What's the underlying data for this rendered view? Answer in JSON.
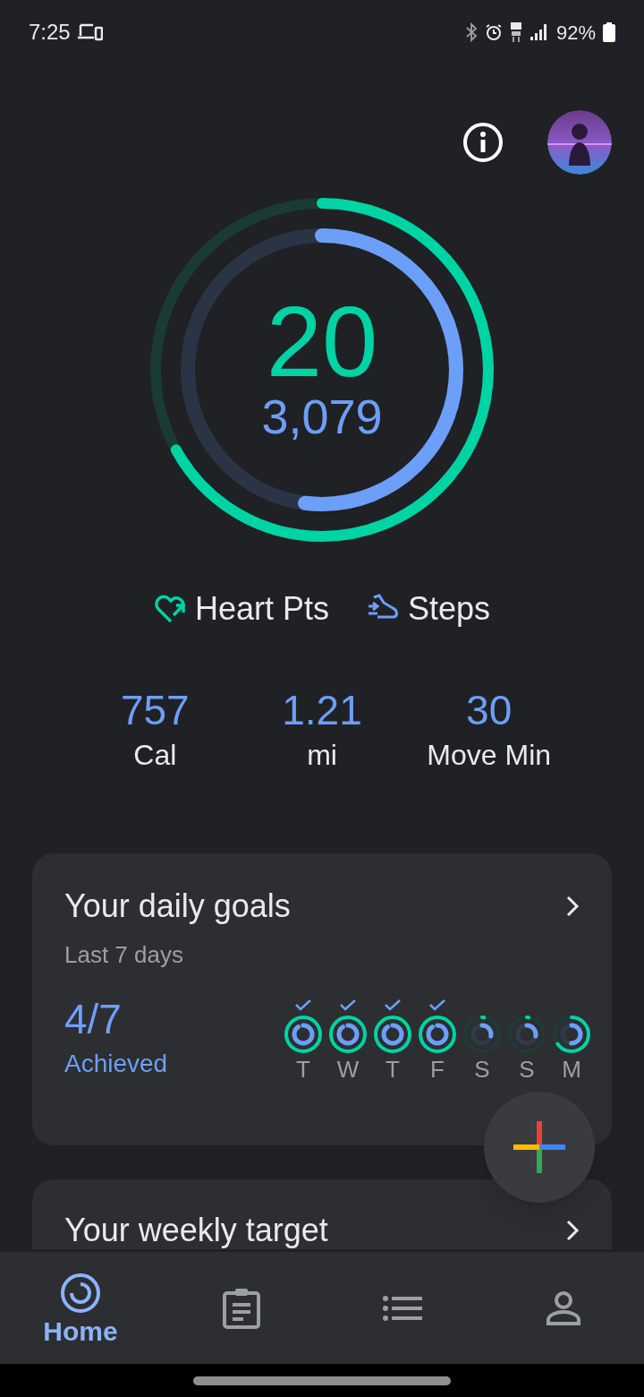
{
  "status_bar": {
    "time": "7:25",
    "battery": "92%"
  },
  "rings": {
    "heart_points": {
      "value": "20",
      "level": 0.67
    },
    "steps": {
      "value": "3,079",
      "level": 0.52
    }
  },
  "legend": [
    {
      "kind": "heart",
      "label": "Heart Pts"
    },
    {
      "kind": "steps",
      "label": "Steps"
    }
  ],
  "stats": [
    {
      "value": "757",
      "label": "Cal"
    },
    {
      "value": "1.21",
      "label": "mi"
    },
    {
      "value": "30",
      "label": "Move Min"
    }
  ],
  "daily_goals": {
    "title": "Your daily goals",
    "subtitle": "Last 7 days",
    "count": "4/7",
    "count_label": "Achieved",
    "days": [
      {
        "label": "T",
        "achieved": true,
        "kind": "complete"
      },
      {
        "label": "W",
        "achieved": true,
        "kind": "complete"
      },
      {
        "label": "T",
        "achieved": true,
        "kind": "complete"
      },
      {
        "label": "F",
        "achieved": true,
        "kind": "complete"
      },
      {
        "label": "S",
        "achieved": false,
        "kind": "low"
      },
      {
        "label": "S",
        "achieved": false,
        "kind": "low"
      },
      {
        "label": "M",
        "achieved": false,
        "kind": "partial"
      }
    ]
  },
  "weekly_target": {
    "title": "Your weekly target"
  },
  "nav": [
    {
      "kind": "home",
      "label": "Home",
      "selected": true
    },
    {
      "kind": "journal",
      "selected": false
    },
    {
      "kind": "browse",
      "selected": false
    },
    {
      "kind": "profile",
      "selected": false
    }
  ]
}
